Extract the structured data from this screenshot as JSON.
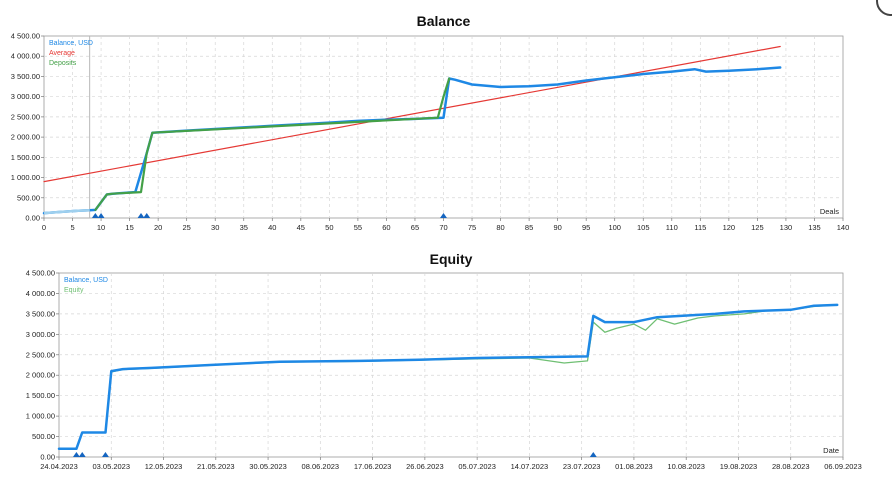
{
  "chart_data": [
    {
      "type": "line",
      "title": "Balance",
      "xlabel": "Deals",
      "ylabel": "",
      "xlim": [
        0,
        140
      ],
      "ylim": [
        0,
        4500
      ],
      "x_ticks": [
        "0",
        "5",
        "10",
        "15",
        "20",
        "25",
        "30",
        "35",
        "40",
        "45",
        "50",
        "55",
        "60",
        "65",
        "70",
        "75",
        "80",
        "85",
        "90",
        "95",
        "100",
        "105",
        "110",
        "115",
        "120",
        "125",
        "130",
        "135",
        "140"
      ],
      "y_ticks": [
        "0.00",
        "500.00",
        "1 000.00",
        "1 500.00",
        "2 000.00",
        "2 500.00",
        "3 000.00",
        "3 500.00",
        "4 000.00",
        "4 500.00"
      ],
      "grid": true,
      "legend_position": "top-left",
      "legend": [
        {
          "label": "Balance, USD",
          "color": "#1e88e5"
        },
        {
          "label": "Average",
          "color": "#e53935"
        },
        {
          "label": "Deposits",
          "color": "#43a047"
        }
      ],
      "series": [
        {
          "name": "Balance, USD",
          "color": "#1e88e5",
          "x": [
            0,
            3,
            6,
            8,
            9,
            11,
            12,
            16,
            18,
            19,
            25,
            30,
            35,
            40,
            45,
            50,
            55,
            60,
            65,
            70,
            71,
            72,
            75,
            80,
            85,
            90,
            95,
            100,
            105,
            110,
            114,
            116,
            120,
            125,
            129
          ],
          "y": [
            120,
            150,
            180,
            190,
            200,
            580,
            600,
            640,
            1600,
            2110,
            2160,
            2200,
            2240,
            2280,
            2320,
            2360,
            2400,
            2430,
            2450,
            2480,
            3450,
            3420,
            3300,
            3240,
            3260,
            3300,
            3400,
            3480,
            3560,
            3620,
            3680,
            3620,
            3640,
            3680,
            3720
          ]
        },
        {
          "name": "Average",
          "color": "#e53935",
          "x": [
            0,
            129
          ],
          "y": [
            900,
            4240
          ]
        },
        {
          "name": "Deposits",
          "color": "#43a047",
          "x": [
            9,
            11,
            12,
            17,
            18,
            19,
            69,
            70,
            71
          ],
          "y": [
            200,
            580,
            600,
            640,
            1600,
            2110,
            2480,
            3000,
            3450
          ]
        }
      ],
      "deposit_markers_x": [
        9,
        10,
        17,
        18,
        70
      ],
      "line_cursor_x": 8
    },
    {
      "type": "line",
      "title": "Equity",
      "xlabel": "Date",
      "ylabel": "",
      "xlim": [
        "24.04.2023",
        "06.09.2023"
      ],
      "ylim": [
        0,
        4500
      ],
      "x_ticks": [
        "24.04.2023",
        "03.05.2023",
        "12.05.2023",
        "21.05.2023",
        "30.05.2023",
        "08.06.2023",
        "17.06.2023",
        "26.06.2023",
        "05.07.2023",
        "14.07.2023",
        "23.07.2023",
        "01.08.2023",
        "10.08.2023",
        "19.08.2023",
        "28.08.2023",
        "06.09.2023"
      ],
      "y_ticks": [
        "0.00",
        "500.00",
        "1 000.00",
        "1 500.00",
        "2 000.00",
        "2 500.00",
        "3 000.00",
        "3 500.00",
        "4 000.00",
        "4 500.00"
      ],
      "grid": true,
      "legend_position": "top-left",
      "legend": [
        {
          "label": "Balance, USD",
          "color": "#1e88e5"
        },
        {
          "label": "Equity",
          "color": "#6fbf73"
        }
      ],
      "series": [
        {
          "name": "Balance, USD",
          "color": "#1e88e5",
          "x": [
            "24.04.2023",
            "27.04.2023",
            "28.04.2023",
            "02.05.2023",
            "03.05.2023",
            "05.05.2023",
            "10.05.2023",
            "20.05.2023",
            "01.06.2023",
            "15.06.2023",
            "25.06.2023",
            "05.07.2023",
            "14.07.2023",
            "20.07.2023",
            "24.07.2023",
            "25.07.2023",
            "27.07.2023",
            "01.08.2023",
            "05.08.2023",
            "15.08.2023",
            "20.08.2023",
            "28.08.2023",
            "01.09.2023",
            "05.09.2023"
          ],
          "y": [
            200,
            200,
            600,
            600,
            2100,
            2150,
            2180,
            2250,
            2330,
            2350,
            2380,
            2420,
            2440,
            2450,
            2460,
            3450,
            3300,
            3300,
            3420,
            3500,
            3560,
            3600,
            3700,
            3720
          ]
        },
        {
          "name": "Equity",
          "color": "#6fbf73",
          "x": [
            "24.04.2023",
            "27.04.2023",
            "28.04.2023",
            "02.05.2023",
            "03.05.2023",
            "05.05.2023",
            "10.05.2023",
            "20.05.2023",
            "01.06.2023",
            "15.06.2023",
            "25.06.2023",
            "05.07.2023",
            "14.07.2023",
            "20.07.2023",
            "24.07.2023",
            "25.07.2023",
            "27.07.2023",
            "29.07.2023",
            "01.08.2023",
            "03.08.2023",
            "05.08.2023",
            "08.08.2023",
            "12.08.2023",
            "15.08.2023",
            "20.08.2023",
            "24.08.2023",
            "28.08.2023",
            "01.09.2023",
            "05.09.2023"
          ],
          "y": [
            200,
            200,
            600,
            600,
            2080,
            2140,
            2170,
            2240,
            2320,
            2340,
            2370,
            2400,
            2420,
            2300,
            2350,
            3300,
            3050,
            3150,
            3250,
            3100,
            3380,
            3250,
            3400,
            3450,
            3500,
            3580,
            3600,
            3680,
            3720
          ]
        }
      ],
      "deposit_markers_x": [
        "27.04.2023",
        "28.04.2023",
        "02.05.2023",
        "25.07.2023"
      ]
    }
  ]
}
